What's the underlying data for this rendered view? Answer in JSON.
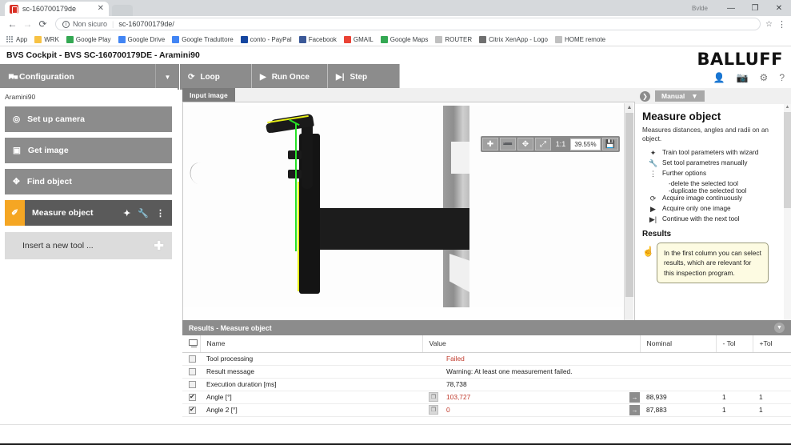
{
  "browser": {
    "tab_title": "sc-160700179de",
    "tab_close": "✕",
    "win_label": "Bvlde",
    "minimize": "—",
    "maximize": "❐",
    "close": "✕",
    "back": "←",
    "forward": "→",
    "reload": "⟳",
    "info_icon": "i",
    "security_text": "Non sicuro",
    "url": "sc-160700179de/",
    "star": "☆",
    "menu": "⋮",
    "bookmarks": [
      {
        "label": "App",
        "icon": "apps-grid-icon",
        "color": "#9aa0a6"
      },
      {
        "label": "WRK",
        "icon": "folder-icon",
        "color": "#f7c244"
      },
      {
        "label": "Google Play",
        "icon": "play-icon",
        "color": "#34a853"
      },
      {
        "label": "Google Drive",
        "icon": "drive-icon",
        "color": "#4285f4"
      },
      {
        "label": "Google Traduttore",
        "icon": "translate-icon",
        "color": "#4285f4"
      },
      {
        "label": "conto - PayPal",
        "icon": "paypal-icon",
        "color": "#1546a0"
      },
      {
        "label": "Facebook",
        "icon": "facebook-icon",
        "color": "#3b5998"
      },
      {
        "label": "GMAIL",
        "icon": "gmail-icon",
        "color": "#ea4335"
      },
      {
        "label": "Google Maps",
        "icon": "maps-icon",
        "color": "#34a853"
      },
      {
        "label": "ROUTER",
        "icon": "page-icon",
        "color": "#c0c0c0"
      },
      {
        "label": "Citrix XenApp - Logo",
        "icon": "lock-icon",
        "color": "#6f6f6f"
      },
      {
        "label": "HOME remote",
        "icon": "page-icon",
        "color": "#c0c0c0"
      }
    ]
  },
  "app": {
    "title": "BVS Cockpit  - BVS SC-160700179DE  - Aramini90",
    "brand": "BALLUFF",
    "toolbar": {
      "config_label": "Configuration",
      "config_icon": "puzzle-icon",
      "dropdown_icon": "▼",
      "loop_label": "Loop",
      "loop_icon": "⟳",
      "run_once_label": "Run Once",
      "run_once_icon": "▶",
      "step_label": "Step",
      "step_icon": "▶|"
    },
    "header_icons": [
      {
        "name": "user-icon",
        "glyph": "👤"
      },
      {
        "name": "camera-icon",
        "glyph": "📷"
      },
      {
        "name": "gear-icon",
        "glyph": "⚙"
      },
      {
        "name": "help-icon",
        "glyph": "?"
      }
    ]
  },
  "sidebar": {
    "user": "Aramini90",
    "items": [
      {
        "label": "Set up camera",
        "icon": "camera-icon",
        "glyph": "◎",
        "active": false
      },
      {
        "label": "Get image",
        "icon": "image-icon",
        "glyph": "▣",
        "active": false
      },
      {
        "label": "Find object",
        "icon": "crosshair-icon",
        "glyph": "✥",
        "active": false
      },
      {
        "label": "Measure object",
        "icon": "ruler-icon",
        "glyph": "✐",
        "active": true
      }
    ],
    "tool_icons": [
      {
        "name": "wizard-wand-icon",
        "glyph": "✦"
      },
      {
        "name": "wrench-icon",
        "glyph": "🔧"
      },
      {
        "name": "more-options-icon",
        "glyph": "⋮"
      }
    ],
    "insert_label": "Insert a new tool ...",
    "insert_plus": "✚"
  },
  "image_panel": {
    "tab_label": "Input image",
    "toolbar": {
      "zoom_in": "✚",
      "zoom_out": "➖",
      "pan": "✥",
      "fit": "⤢",
      "one_to_one": "1:1",
      "zoom_value": "39.55%",
      "save_icon": "💾"
    },
    "scroll_up": "▲",
    "scroll_down": "▼"
  },
  "right_panel": {
    "expand_icon": "❯",
    "mode_label": "Manual",
    "mode_caret": "▼",
    "title": "Measure object",
    "description": "Measures distances, angles and radii on an object.",
    "options": [
      {
        "icon": "wand-icon",
        "glyph": "✦",
        "label": "Train tool parameters with wizard"
      },
      {
        "icon": "wrench-icon",
        "glyph": "🔧",
        "label": "Set tool parametres manually"
      },
      {
        "icon": "more-options-icon",
        "glyph": "⋮",
        "label": "Further options"
      },
      {
        "icon": "loop-icon",
        "glyph": "⟳",
        "label": "Acquire image continuously"
      },
      {
        "icon": "play-icon",
        "glyph": "▶",
        "label": "Acquire only one image"
      },
      {
        "icon": "step-icon",
        "glyph": "▶|",
        "label": "Continue with the next tool"
      }
    ],
    "sub_options": [
      "-delete the selected tool",
      "-duplicate the selected tool"
    ],
    "results_heading": "Results",
    "tooltip_icon": "☝",
    "tooltip": "In the first column you can select results, which are relevant for this inspection program."
  },
  "results": {
    "panel_title": "Results - Measure object",
    "collapse_icon": "▼",
    "columns": [
      "",
      "Name",
      "Value",
      "Nominal",
      "- Tol",
      "+Tol"
    ],
    "header_icon": "monitor-icon",
    "rows": [
      {
        "checked": false,
        "name": "Tool processing",
        "value": "Failed",
        "value_red": true,
        "has_value_button": false,
        "has_arrow": false,
        "nominal": "",
        "tol_minus": "",
        "tol_plus": ""
      },
      {
        "checked": false,
        "name": "Result message",
        "value": "Warning: At least one measurement failed.",
        "value_red": false,
        "has_value_button": false,
        "has_arrow": false,
        "nominal": "",
        "tol_minus": "",
        "tol_plus": ""
      },
      {
        "checked": false,
        "name": "Execution duration [ms]",
        "value": "78,738",
        "value_red": false,
        "has_value_button": false,
        "has_arrow": false,
        "nominal": "",
        "tol_minus": "",
        "tol_plus": ""
      },
      {
        "checked": true,
        "name": "Angle [°]",
        "value": "103,727",
        "value_red": true,
        "has_value_button": true,
        "has_arrow": true,
        "nominal": "88,939",
        "tol_minus": "1",
        "tol_plus": "1"
      },
      {
        "checked": true,
        "name": "Angle 2 [°]",
        "value": "0",
        "value_red": true,
        "has_value_button": true,
        "has_arrow": true,
        "nominal": "87,883",
        "tol_minus": "1",
        "tol_plus": "1"
      }
    ]
  },
  "colors": {
    "accent_orange": "#f5a623",
    "toolbar_gray": "#8c8c8c",
    "active_item": "#5a5a5a",
    "error_red": "#c0392b",
    "overlay_green": "#27e327",
    "overlay_yellow": "#e8f018"
  }
}
